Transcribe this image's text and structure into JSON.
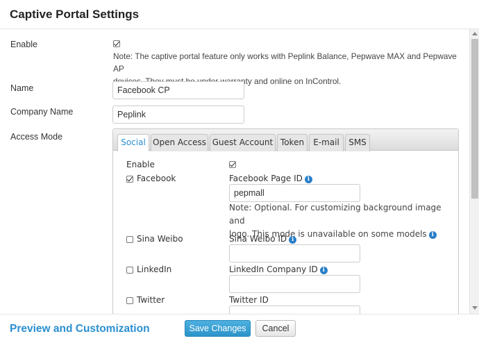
{
  "dialog": {
    "title": "Captive Portal Settings"
  },
  "fields": {
    "enable_label": "Enable",
    "enable_checked": true,
    "enable_note_line1": "Note: The captive portal feature only works with Peplink Balance, Pepwave MAX and Pepwave AP",
    "enable_note_line2": "devices. They must be under warranty and online on InControl.",
    "name_label": "Name",
    "name_value": "Facebook CP",
    "company_label": "Company Name",
    "company_value": "Peplink",
    "access_mode_label": "Access Mode"
  },
  "tabs": [
    {
      "label": "Social",
      "active": true
    },
    {
      "label": "Open Access",
      "active": false
    },
    {
      "label": "Guest Account",
      "active": false
    },
    {
      "label": "Token",
      "active": false
    },
    {
      "label": "E-mail",
      "active": false
    },
    {
      "label": "SMS",
      "active": false
    }
  ],
  "social": {
    "enable_label": "Enable",
    "enable_checked": true,
    "facebook": {
      "label": "Facebook",
      "checked": true,
      "field_label": "Facebook Page ID",
      "field_value": "pepmall",
      "note_line1": "Note: Optional. For customizing background image and",
      "note_line2": "logo. This mode is unavailable on some models"
    },
    "weibo": {
      "label": "Sina Weibo",
      "checked": false,
      "field_label": "Sina Weibo ID",
      "field_value": ""
    },
    "linkedin": {
      "label": "LinkedIn",
      "checked": false,
      "field_label": "LinkedIn Company ID",
      "field_value": ""
    },
    "twitter": {
      "label": "Twitter",
      "checked": false,
      "field_label": "Twitter ID",
      "field_value": ""
    }
  },
  "footer": {
    "preview_label": "Preview and Customization",
    "save_label": "Save Changes",
    "cancel_label": "Cancel"
  },
  "icons": {
    "info": "info-circle-icon",
    "check": "checkmark-icon"
  },
  "colors": {
    "accent": "#2a8fd0",
    "primary_button": "#3aa3d6",
    "info_icon": "#2a7fc9"
  }
}
